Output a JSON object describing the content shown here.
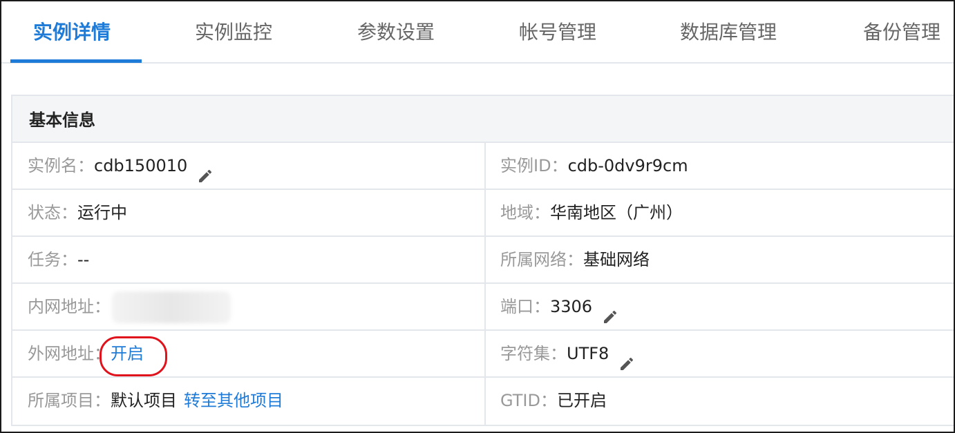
{
  "tabs": [
    {
      "label": "实例详情",
      "active": true
    },
    {
      "label": "实例监控"
    },
    {
      "label": "参数设置"
    },
    {
      "label": "帐号管理"
    },
    {
      "label": "数据库管理"
    },
    {
      "label": "备份管理"
    }
  ],
  "panel": {
    "title": "基本信息"
  },
  "rows": [
    {
      "left": {
        "label": "实例名：",
        "value": "cdb150010",
        "editable": true
      },
      "right": {
        "label": "实例ID：",
        "value": "cdb-0dv9r9cm"
      }
    },
    {
      "left": {
        "label": "状态：",
        "value": "运行中"
      },
      "right": {
        "label": "地域：",
        "value": "华南地区（广州）"
      }
    },
    {
      "left": {
        "label": "任务：",
        "value": "--"
      },
      "right": {
        "label": "所属网络：",
        "value": "基础网络"
      }
    },
    {
      "left": {
        "label": "内网地址：",
        "value": ""
      },
      "right": {
        "label": "端口：",
        "value": "3306",
        "editable": true
      }
    },
    {
      "left": {
        "label": "外网地址：",
        "link": "开启"
      },
      "right": {
        "label": "字符集：",
        "value": "UTF8",
        "editable": true
      }
    },
    {
      "left": {
        "label": "所属项目：",
        "value": "默认项目",
        "link": "转至其他项目"
      },
      "right": {
        "label": "GTID：",
        "value": "已开启"
      }
    }
  ],
  "colors": {
    "accent": "#1f7bd8",
    "highlight": "#e0121c",
    "label": "#999999",
    "border": "#e3e6ea"
  },
  "icons": {
    "edit": "pencil-icon"
  }
}
